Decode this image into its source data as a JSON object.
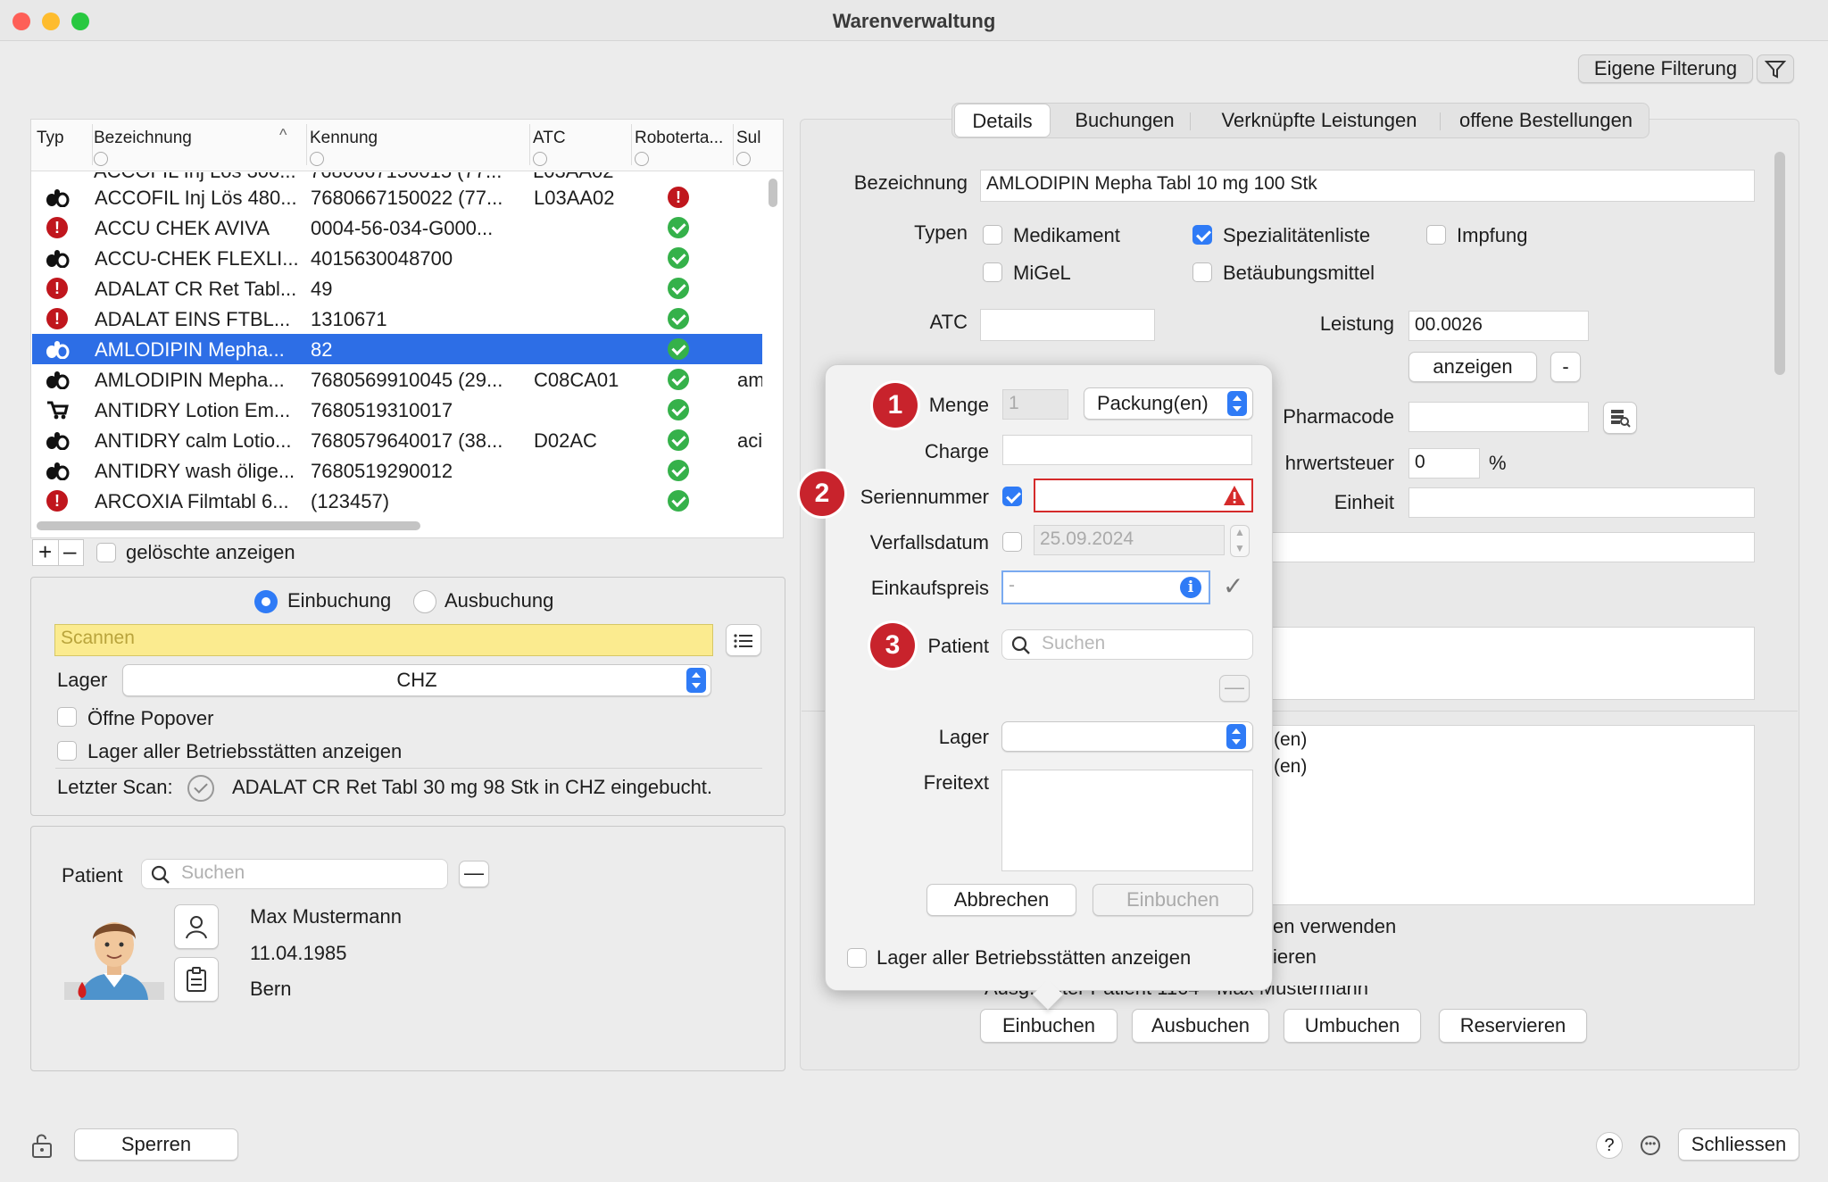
{
  "window": {
    "title": "Warenverwaltung"
  },
  "toolbar": {
    "filter_button": "Eigene Filterung"
  },
  "table": {
    "columns": [
      "Typ",
      "Bezeichnung",
      "Kennung",
      "ATC",
      "Roboterta...",
      "Sul"
    ],
    "partial_top_row": {
      "name": "ACCOFIL Inj Lös 300...",
      "code": "7680667150015 (77...",
      "atc": "L03AA02"
    },
    "rows": [
      {
        "type": "pill-icon",
        "name": "ACCOFIL Inj Lös 480...",
        "code": "7680667150022 (77...",
        "atc": "L03AA02",
        "status": "error",
        "sub": ""
      },
      {
        "type": "error-icon",
        "name": "ACCU CHEK AVIVA",
        "code": "0004-56-034-G000...",
        "atc": "",
        "status": "ok",
        "sub": ""
      },
      {
        "type": "pill-icon",
        "name": "ACCU-CHEK FLEXLI...",
        "code": "4015630048700",
        "atc": "",
        "status": "ok",
        "sub": ""
      },
      {
        "type": "error-icon",
        "name": "ADALAT CR Ret Tabl...",
        "code": "49",
        "atc": "",
        "status": "ok",
        "sub": ""
      },
      {
        "type": "error-icon",
        "name": "ADALAT EINS FTBL...",
        "code": "1310671",
        "atc": "",
        "status": "ok",
        "sub": ""
      },
      {
        "type": "pill-icon",
        "name": "AMLODIPIN Mepha...",
        "code": "82",
        "atc": "",
        "status": "ok",
        "sub": "",
        "selected": true
      },
      {
        "type": "pill-icon",
        "name": "AMLODIPIN Mepha...",
        "code": "7680569910045 (29...",
        "atc": "C08CA01",
        "status": "ok",
        "sub": "am"
      },
      {
        "type": "cart-icon",
        "name": "ANTIDRY Lotion Em...",
        "code": "7680519310017",
        "atc": "",
        "status": "ok",
        "sub": ""
      },
      {
        "type": "pill-icon",
        "name": "ANTIDRY calm Lotio...",
        "code": "7680579640017 (38...",
        "atc": "D02AC",
        "status": "ok",
        "sub": "aci"
      },
      {
        "type": "pill-icon",
        "name": "ANTIDRY wash ölige...",
        "code": "7680519290012",
        "atc": "",
        "status": "ok",
        "sub": ""
      },
      {
        "type": "error-icon",
        "name": "ARCOXIA Filmtabl 6...",
        "code": "(123457)",
        "atc": "",
        "status": "ok",
        "sub": ""
      }
    ],
    "show_deleted_label": "gelöschte anzeigen"
  },
  "booking": {
    "mode_in": "Einbuchung",
    "mode_out": "Ausbuchung",
    "scan_placeholder": "Scannen",
    "lager_label": "Lager",
    "lager_value": "CHZ",
    "open_popover_label": "Öffne Popover",
    "all_sites_label": "Lager aller Betriebsstätten anzeigen",
    "last_scan_label": "Letzter Scan:",
    "last_scan_text": "ADALAT CR Ret Tabl 30 mg 98 Stk in CHZ eingebucht."
  },
  "patient_panel": {
    "label": "Patient",
    "search_placeholder": "Suchen",
    "name": "Max Mustermann",
    "birthdate": "11.04.1985",
    "city": "Bern"
  },
  "details": {
    "tabs": [
      "Details",
      "Buchungen",
      "Verknüpfte Leistungen",
      "offene Bestellungen"
    ],
    "bezeichnung_label": "Bezeichnung",
    "bezeichnung_value": "AMLODIPIN Mepha Tabl 10 mg 100 Stk",
    "typen_label": "Typen",
    "typ_medikament": "Medikament",
    "typ_spezialitaeten": "Spezialitätenliste",
    "typ_impfung": "Impfung",
    "typ_migel": "MiGeL",
    "typ_betaeubung": "Betäubungsmittel",
    "atc_label": "ATC",
    "leistung_label": "Leistung",
    "leistung_value": "00.0026",
    "anzeigen_button": "anzeigen",
    "minus_button": "-",
    "pharmacode_label": "Pharmacode",
    "mwst_label": "hrwertsteuer",
    "mwst_value": "0",
    "mwst_unit": "%",
    "einheit_label": "Einheit",
    "unit_line_1": "(en)",
    "unit_line_2": "(en)",
    "option_1": "en verwenden",
    "option_2": "ieren",
    "patient_line": "Ausg... hter Patient 1164 - Max Mustermann",
    "btn_einbuchen": "Einbuchen",
    "btn_ausbuchen": "Ausbuchen",
    "btn_umbuchen": "Umbuchen",
    "btn_reservieren": "Reservieren"
  },
  "popover": {
    "badge_1": "1",
    "badge_2": "2",
    "badge_3": "3",
    "menge_label": "Menge",
    "menge_value": "1",
    "unit_select": "Packung(en)",
    "charge_label": "Charge",
    "serial_label": "Seriennummer",
    "expiry_label": "Verfallsdatum",
    "expiry_value": "25.09.2024",
    "price_label": "Einkaufspreis",
    "price_value": "-",
    "patient_label": "Patient",
    "patient_placeholder": "Suchen",
    "lager_label": "Lager",
    "freitext_label": "Freitext",
    "cancel_button": "Abbrechen",
    "submit_button": "Einbuchen",
    "all_sites_label": "Lager aller Betriebsstätten anzeigen"
  },
  "footer": {
    "lock_button": "Sperren",
    "help": "?",
    "close_button": "Schliessen"
  },
  "colors": {
    "accent": "#2f7bf6",
    "selection": "#2d6ee6",
    "error": "#c0161d",
    "ok": "#35b14a",
    "scan_field": "#fbeb8f"
  }
}
